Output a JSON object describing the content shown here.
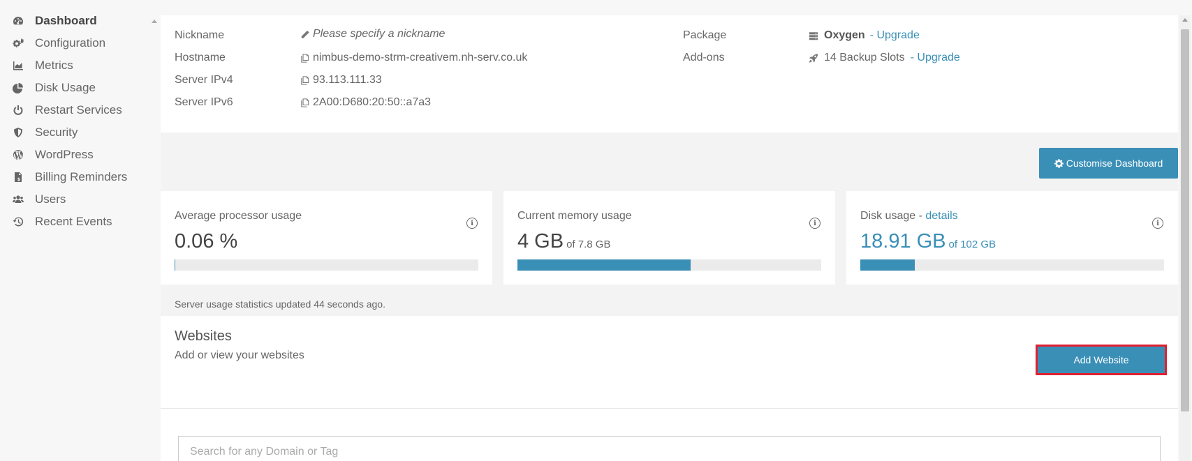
{
  "sidebar": {
    "items": [
      {
        "label": "Dashboard",
        "icon": "dashboard-icon",
        "active": true
      },
      {
        "label": "Configuration",
        "icon": "cogs-icon"
      },
      {
        "label": "Metrics",
        "icon": "area-chart-icon"
      },
      {
        "label": "Disk Usage",
        "icon": "pie-chart-icon"
      },
      {
        "label": "Restart Services",
        "icon": "power-icon"
      },
      {
        "label": "Security",
        "icon": "shield-icon"
      },
      {
        "label": "WordPress",
        "icon": "wordpress-icon"
      },
      {
        "label": "Billing Reminders",
        "icon": "invoice-icon"
      },
      {
        "label": "Users",
        "icon": "users-icon"
      },
      {
        "label": "Recent Events",
        "icon": "history-icon"
      }
    ]
  },
  "server_info": {
    "nickname_label": "Nickname",
    "nickname_placeholder": "Please specify a nickname",
    "hostname_label": "Hostname",
    "hostname_value": "nimbus-demo-strm-creativem.nh-serv.co.uk",
    "ipv4_label": "Server IPv4",
    "ipv4_value": "93.113.111.33",
    "ipv6_label": "Server IPv6",
    "ipv6_value": "2A00:D680:20:50::a7a3",
    "package_label": "Package",
    "package_value": "Oxygen",
    "package_upgrade": "- Upgrade",
    "addons_label": "Add-ons",
    "addons_value": "14 Backup Slots",
    "addons_upgrade": "- Upgrade"
  },
  "toolbar": {
    "customise_label": "Customise Dashboard"
  },
  "usage": {
    "cpu": {
      "title": "Average processor usage",
      "value": "0.06 %",
      "fraction": 0.0006
    },
    "memory": {
      "title": "Current memory usage",
      "value": "4 GB",
      "of": "of 7.8 GB",
      "fraction": 0.57
    },
    "disk": {
      "title": "Disk usage",
      "details_link": "details",
      "title_sep": " - ",
      "value": "18.91 GB",
      "of": "of 102 GB",
      "fraction": 0.18
    },
    "note": "Server usage statistics updated 44 seconds ago."
  },
  "websites": {
    "title": "Websites",
    "subtitle": "Add or view your websites",
    "add_label": "Add Website",
    "search_placeholder": "Search for any Domain or Tag"
  },
  "colors": {
    "accent": "#3a8fb7",
    "highlight_border": "#e0202f"
  }
}
